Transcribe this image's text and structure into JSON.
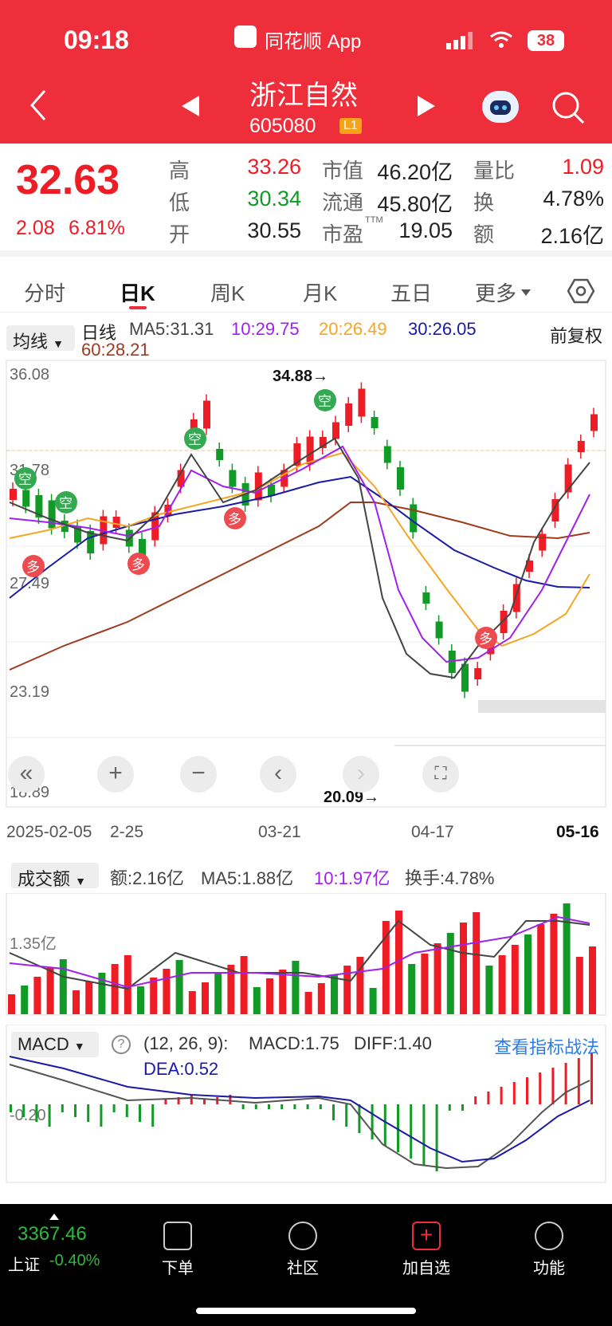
{
  "status": {
    "time": "09:18",
    "app": "同花顺 App",
    "battery": "38"
  },
  "stock": {
    "name": "浙江自然",
    "code": "605080",
    "badge": "L1"
  },
  "quote": {
    "price": "32.63",
    "change": "2.08",
    "pct": "6.81%",
    "high_l": "高",
    "high": "33.26",
    "low_l": "低",
    "low": "30.34",
    "open_l": "开",
    "open": "30.55",
    "mcap_l": "市值",
    "mcap": "46.20亿",
    "float_l": "流通",
    "float": "45.80亿",
    "pe_l": "市盈",
    "pe_sup": "TTM",
    "pe": "19.05",
    "vr_l": "量比",
    "vr": "1.09",
    "turn_l": "换",
    "turn": "4.78%",
    "amt_l": "额",
    "amt": "2.16亿"
  },
  "tabs": [
    "分时",
    "日K",
    "周K",
    "月K",
    "五日",
    "更多"
  ],
  "ma": {
    "btn": "均线",
    "period": "日线",
    "ma5": "MA5:31.31",
    "ma10": "10:29.75",
    "ma20": "20:26.49",
    "ma30": "30:26.05",
    "ma60": "60:28.21",
    "adj": "前复权"
  },
  "price_axis": [
    "36.08",
    "31.78",
    "27.49",
    "23.19",
    "18.89"
  ],
  "hi_label": "34.88→",
  "lo_label": "20.09→",
  "signals": {
    "kong": "空",
    "duo": "多"
  },
  "dates": [
    "2025-02-05",
    "2-25",
    "03-21",
    "04-17",
    "05-16"
  ],
  "vol": {
    "btn": "成交额",
    "amt": "额:2.16亿",
    "ma5": "MA5:1.88亿",
    "ma10": "10:1.97亿",
    "turn": "换手:4.78%",
    "axis": "1.35亿"
  },
  "macd": {
    "btn": "MACD",
    "params": "(12, 26, 9):",
    "macd": "MACD:1.75",
    "diff": "DIFF:1.40",
    "dea": "DEA:0.52",
    "link": "查看指标战法",
    "axis": "-0.20"
  },
  "bottom": {
    "index": "3367.46",
    "index_name": "上证",
    "index_pct": "-0.40%",
    "items": [
      "下单",
      "社区",
      "加自选",
      "功能"
    ]
  },
  "colors": {
    "up": "#ee1c25",
    "down": "#119a26",
    "header": "#ee2e3a",
    "ma5": "#444444",
    "ma10": "#a020f0",
    "ma20": "#f5a623",
    "ma30": "#1a1aa6",
    "ma60": "#a0391e"
  }
}
